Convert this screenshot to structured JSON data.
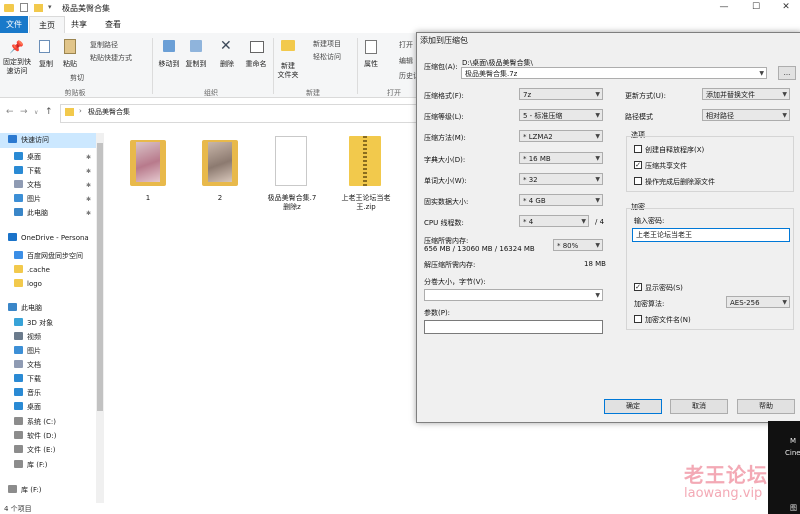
{
  "explorer": {
    "title": "极品美臀合集",
    "tabs": [
      "文件",
      "主页",
      "共享",
      "查看"
    ],
    "ribbon": {
      "pin_label": "固定到快速访问",
      "copy": "复制",
      "paste": "粘贴",
      "copy_path": "复制路径",
      "paste_shortcut": "粘贴快捷方式",
      "cut": "剪切",
      "clipboard_group": "剪贴板",
      "move_to": "移动到",
      "copy_to": "复制到",
      "delete": "删除",
      "rename": "重命名",
      "organize_group": "组织",
      "new_folder": "新建\n文件夹",
      "new_item": "新建项目",
      "easy_access": "轻松访问",
      "new_group": "新建",
      "properties": "属性",
      "open": "打开",
      "edit": "编辑",
      "history": "历史记",
      "open_group": "打开"
    },
    "address": "极品美臀合集",
    "nav": [
      {
        "label": "快速访问",
        "icon": "star-icon",
        "color": "#2b79d0",
        "selected": true
      },
      {
        "label": "桌面",
        "icon": "desktop-icon",
        "color": "#2a8ad4",
        "pinned": true
      },
      {
        "label": "下载",
        "icon": "download-icon",
        "color": "#2a8ad4",
        "pinned": true
      },
      {
        "label": "文档",
        "icon": "document-icon",
        "color": "#8f9bb3",
        "pinned": true
      },
      {
        "label": "图片",
        "icon": "pictures-icon",
        "color": "#3c8fd6",
        "pinned": true
      },
      {
        "label": "此电脑",
        "icon": "pc-icon",
        "color": "#3a86c8",
        "pinned": true
      },
      {
        "label": "OneDrive - Persona",
        "icon": "cloud-icon",
        "color": "#1a73c9"
      },
      {
        "label": "百度网盘同步空间",
        "icon": "baidu-icon",
        "color": "#3b8ee6"
      },
      {
        "label": ".cache",
        "icon": "folder-icon",
        "color": "#f2c94c"
      },
      {
        "label": "logo",
        "icon": "folder-icon",
        "color": "#f2c94c"
      },
      {
        "label": "此电脑",
        "icon": "pc-icon",
        "color": "#3a86c8"
      },
      {
        "label": "3D 对象",
        "icon": "cube-icon",
        "color": "#38a3d8"
      },
      {
        "label": "视频",
        "icon": "video-icon",
        "color": "#6b7b8c"
      },
      {
        "label": "图片",
        "icon": "pictures-icon",
        "color": "#3c8fd6"
      },
      {
        "label": "文档",
        "icon": "document-icon",
        "color": "#8f9bb3"
      },
      {
        "label": "下载",
        "icon": "download-icon",
        "color": "#2a8ad4"
      },
      {
        "label": "音乐",
        "icon": "music-icon",
        "color": "#2a8ad4"
      },
      {
        "label": "桌面",
        "icon": "desktop-icon",
        "color": "#2a8ad4"
      },
      {
        "label": "系统 (C:)",
        "icon": "drive-icon",
        "color": "#8c8c8c"
      },
      {
        "label": "软件 (D:)",
        "icon": "drive-icon",
        "color": "#8c8c8c"
      },
      {
        "label": "文件 (E:)",
        "icon": "drive-icon",
        "color": "#8c8c8c"
      },
      {
        "label": "库 (F:)",
        "icon": "drive-icon",
        "color": "#8c8c8c"
      },
      {
        "label": "库 (F:)",
        "icon": "drive-icon",
        "color": "#8c8c8c"
      }
    ],
    "items": [
      {
        "name": "1",
        "kind": "folder-photo"
      },
      {
        "name": "2",
        "kind": "folder-photo"
      },
      {
        "name": "极品美臀合集.7\n删除z",
        "kind": "file"
      },
      {
        "name": "上老王论坛当老\n王.zip",
        "kind": "zip"
      }
    ],
    "status": "4 个项目"
  },
  "dialog": {
    "title": "添加到压缩包",
    "archive_label": "压缩包(A):",
    "archive_path": "D:\\桌面\\极品美臀合集\\",
    "archive_name": "极品美臀合集.7z",
    "browse": "...",
    "format_label": "压缩格式(F):",
    "format_value": "7z",
    "level_label": "压缩等级(L):",
    "level_value": "5 - 标准压缩",
    "method_label": "压缩方法(M):",
    "method_value": "* LZMA2",
    "dict_label": "字典大小(D):",
    "dict_value": "* 16 MB",
    "word_label": "单词大小(W):",
    "word_value": "* 32",
    "solid_label": "固实数据大小:",
    "solid_value": "* 4 GB",
    "threads_label": "CPU 线程数:",
    "threads_value": "* 4",
    "threads_max": "/ 4",
    "mem_comp_label": "压缩所需内存:",
    "mem_comp_value": "656 MB / 13060 MB / 16324 MB",
    "mem_pct": "* 80%",
    "mem_decomp_label": "解压缩所需内存:",
    "mem_decomp_value": "18 MB",
    "split_label": "分卷大小，字节(V):",
    "params_label": "参数(P):",
    "update_label": "更新方式(U):",
    "update_value": "添加并替换文件",
    "path_label": "路径模式",
    "path_value": "相对路径",
    "options_title": "选项",
    "opt_sfx": "创建自释放程序(X)",
    "opt_shared": "压缩共享文件",
    "opt_delete": "操作完成后删除源文件",
    "encrypt_title": "加密",
    "password_label": "输入密码:",
    "password_value": "上老王论坛当老王",
    "show_password": "显示密码(S)",
    "enc_method_label": "加密算法:",
    "enc_method_value": "AES-256",
    "enc_names": "加密文件名(N)",
    "ok": "确定",
    "cancel": "取消",
    "help": "帮助"
  },
  "watermark": {
    "cn": "老王论坛",
    "en": "laowang.vip"
  },
  "taskbar_peek": {
    "a": "M",
    "b": "Cine",
    "c": "图"
  }
}
